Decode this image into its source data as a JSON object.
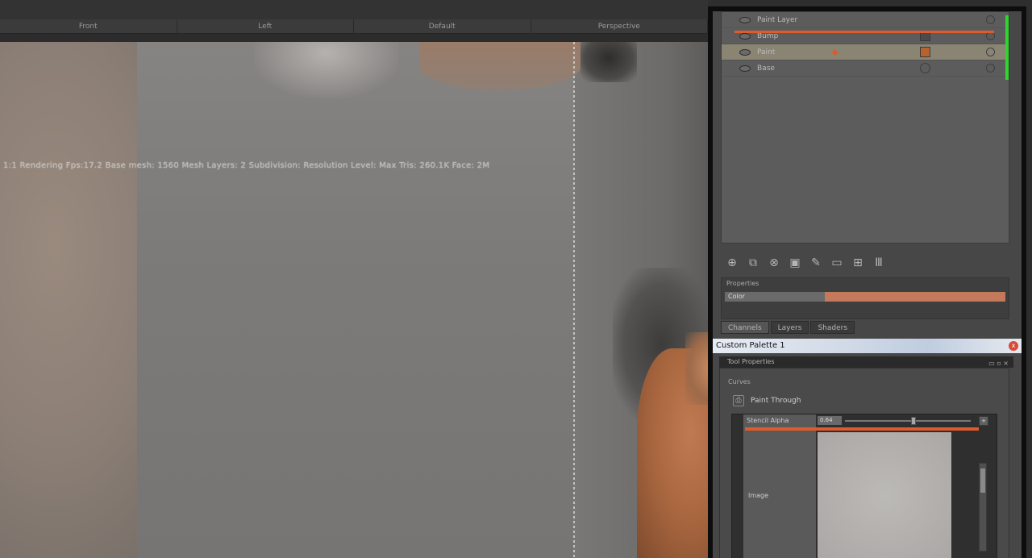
{
  "viewport": {
    "headers": [
      "Front",
      "Left",
      "Default",
      "Perspective"
    ],
    "overlay_text": "1:1  Rendering  Fps:17.2  Base mesh: 1560  Mesh Layers: 2  Subdivision: Resolution Level: Max  Tris: 260.1K  Face: 2M"
  },
  "layers": {
    "rows": [
      {
        "name": "Paint Layer"
      },
      {
        "name": "Bump"
      },
      {
        "name": "Paint"
      },
      {
        "name": "Base"
      }
    ],
    "accent": "#e05a2b",
    "green": "#2fd42f"
  },
  "tools": {
    "icons": [
      "add-layer-icon",
      "duplicate-layer-icon",
      "merge-layer-icon",
      "mask-icon",
      "paint-layer-icon",
      "folder-icon",
      "group-icon",
      "delete-icon"
    ]
  },
  "blend": {
    "label": "Properties",
    "value": "Color",
    "fill_percent": 65
  },
  "tabs": [
    "Channels",
    "Layers",
    "Shaders"
  ],
  "palette": {
    "title": "Custom Palette 1",
    "close": "x"
  },
  "tool_properties": {
    "header": "Tool Properties",
    "header_buttons": "▭ ▫ ×",
    "group": "Curves",
    "tool_name": "Paint Through",
    "row_label": "Stencil Alpha",
    "row_value": "0.64",
    "image_label": "Image",
    "corner_btn": "+",
    "preview_color": "#aaa7a4"
  }
}
